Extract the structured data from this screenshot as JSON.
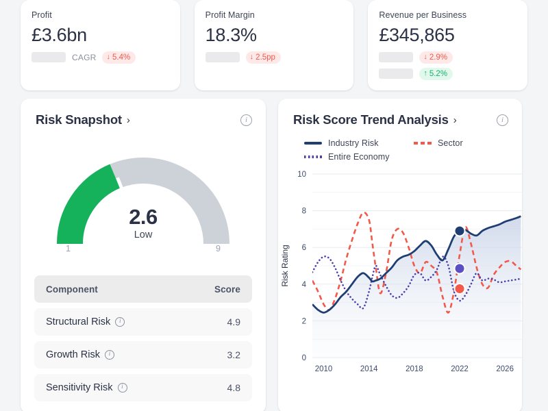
{
  "kpis": [
    {
      "label": "Profit",
      "value": "£3.6bn",
      "metrics": [
        {
          "skeleton": true,
          "note": "CAGR",
          "badge": {
            "dir": "down",
            "arrow": "↓",
            "text": "5.4%"
          }
        }
      ]
    },
    {
      "label": "Profit Margin",
      "value": "18.3%",
      "metrics": [
        {
          "skeleton": true,
          "note": "",
          "badge": {
            "dir": "down",
            "arrow": "↓",
            "text": "2.5pp"
          }
        }
      ]
    },
    {
      "label": "Revenue per Business",
      "value": "£345,865",
      "metrics": [
        {
          "skeleton": true,
          "note": "",
          "badge": {
            "dir": "down",
            "arrow": "↓",
            "text": "2.9%"
          }
        },
        {
          "skeleton": true,
          "note": "",
          "badge": {
            "dir": "up",
            "arrow": "↑",
            "text": "5.2%"
          }
        }
      ]
    }
  ],
  "risk_snapshot": {
    "title": "Risk Snapshot",
    "chevron": "›",
    "gauge": {
      "value": "2.6",
      "band": "Low",
      "min_label": "1",
      "max_label": "9",
      "min": 1,
      "max": 9,
      "value_num": 2.6,
      "fill_color": "#16b25b",
      "track_color": "#ccd2d8"
    },
    "table": {
      "columns": [
        "Component",
        "Score"
      ],
      "rows": [
        {
          "name": "Structural Risk",
          "score": "4.9"
        },
        {
          "name": "Growth Risk",
          "score": "3.2"
        },
        {
          "name": "Sensitivity Risk",
          "score": "4.8"
        }
      ]
    }
  },
  "trend": {
    "title": "Risk Score Trend Analysis",
    "chevron": "›",
    "legend": [
      {
        "label": "Industry Risk",
        "color": "#1f3f73",
        "style": "solid"
      },
      {
        "label": "Sector",
        "color": "#f2594b",
        "style": "dashed"
      },
      {
        "label": "Entire Economy",
        "color": "#4b3fae",
        "style": "dotted"
      }
    ]
  },
  "chart_data": {
    "type": "line",
    "title": "Risk Score Trend Analysis",
    "xlabel": "",
    "ylabel": "Risk Rating",
    "xlim": [
      2009,
      2027.5
    ],
    "ylim": [
      0,
      10
    ],
    "xticks": [
      2010,
      2014,
      2018,
      2022,
      2026
    ],
    "yticks": [
      0,
      2,
      4,
      6,
      8,
      10
    ],
    "grid": true,
    "legend_position": "top-left",
    "x": [
      2009.0,
      2009.5,
      2010.0,
      2010.5,
      2011.0,
      2011.5,
      2012.0,
      2012.5,
      2013.0,
      2013.5,
      2014.0,
      2014.3,
      2014.6,
      2015.0,
      2015.5,
      2016.0,
      2016.5,
      2017.0,
      2017.5,
      2018.0,
      2018.5,
      2019.0,
      2019.5,
      2020.0,
      2020.5,
      2021.0,
      2021.5,
      2022.0,
      2022.5,
      2023.0,
      2023.5,
      2024.0,
      2024.5,
      2025.0,
      2025.5,
      2026.0,
      2026.5,
      2027.0,
      2027.4
    ],
    "series": [
      {
        "name": "Industry Risk",
        "color": "#1f3f73",
        "style": "solid",
        "values": [
          2.9,
          2.6,
          2.45,
          2.6,
          2.9,
          3.3,
          3.6,
          4.0,
          4.4,
          4.6,
          4.35,
          4.15,
          4.2,
          4.3,
          4.6,
          4.9,
          5.3,
          5.5,
          5.6,
          5.8,
          6.1,
          6.35,
          6.1,
          5.6,
          5.3,
          5.9,
          6.6,
          6.9,
          6.95,
          6.75,
          6.65,
          6.9,
          7.05,
          7.15,
          7.25,
          7.4,
          7.5,
          7.6,
          7.7
        ]
      },
      {
        "name": "Sector",
        "color": "#f2594b",
        "style": "dashed",
        "values": [
          4.2,
          3.6,
          2.9,
          2.6,
          3.2,
          4.2,
          5.4,
          6.4,
          7.3,
          7.9,
          7.5,
          6.2,
          4.9,
          3.5,
          4.6,
          6.4,
          7.0,
          6.8,
          6.0,
          5.0,
          4.6,
          5.2,
          5.0,
          4.6,
          3.3,
          2.45,
          3.6,
          5.6,
          7.1,
          6.2,
          4.9,
          4.0,
          3.8,
          4.5,
          4.9,
          5.2,
          5.25,
          5.0,
          4.8
        ]
      },
      {
        "name": "Entire Economy",
        "color": "#4b3fae",
        "style": "dotted",
        "values": [
          4.65,
          5.2,
          5.5,
          5.4,
          4.9,
          4.2,
          3.6,
          3.2,
          2.9,
          2.7,
          3.6,
          4.4,
          5.0,
          4.5,
          3.9,
          3.4,
          3.25,
          3.5,
          3.9,
          4.5,
          4.6,
          4.2,
          4.4,
          4.8,
          5.5,
          5.0,
          3.6,
          3.1,
          3.4,
          4.0,
          4.6,
          4.2,
          4.3,
          4.25,
          4.1,
          4.15,
          4.2,
          4.25,
          4.3
        ]
      }
    ],
    "markers": [
      {
        "series": "Industry Risk",
        "x": 2022.0,
        "y": 6.9,
        "color": "#1f3f73"
      },
      {
        "series": "Entire Economy",
        "x": 2022.0,
        "y": 4.85,
        "color": "#5b4fc4"
      },
      {
        "series": "Sector",
        "x": 2022.0,
        "y": 3.75,
        "color": "#f2594b"
      }
    ]
  }
}
